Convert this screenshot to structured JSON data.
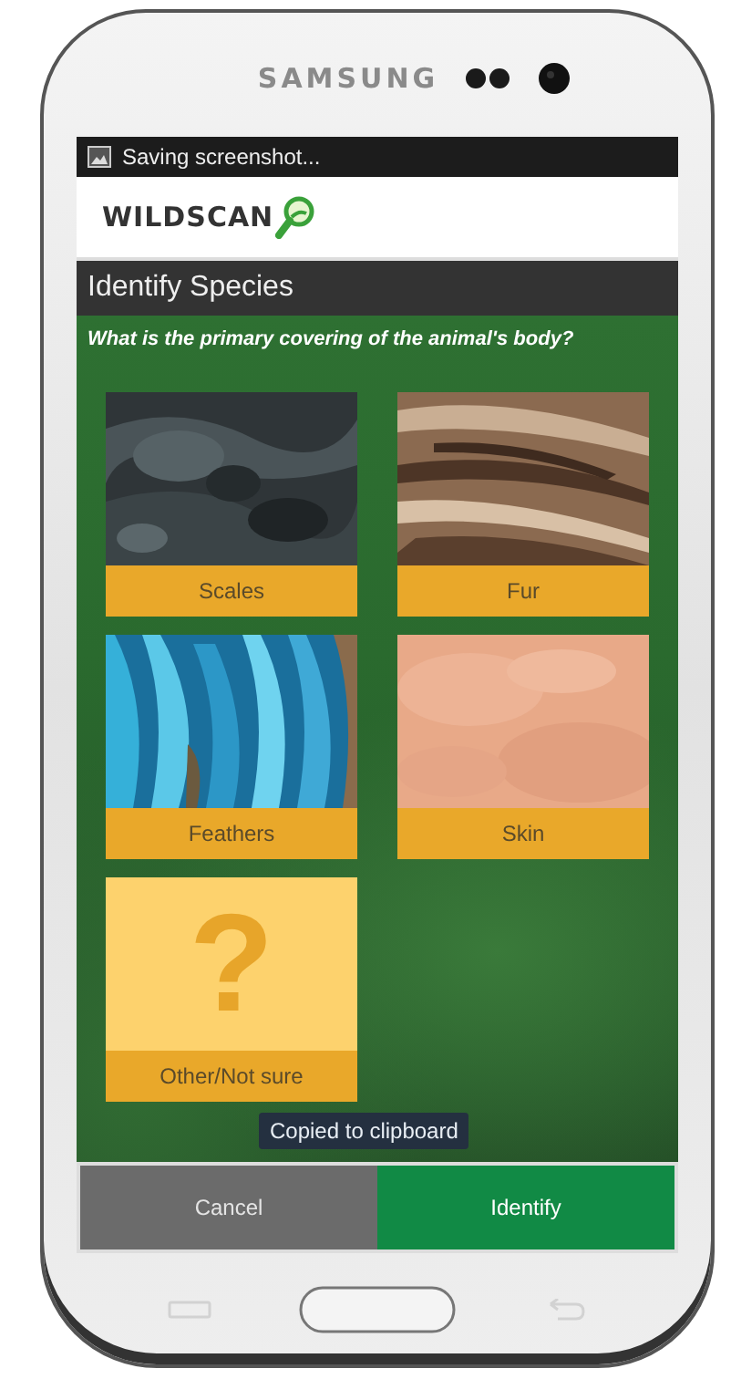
{
  "device": {
    "brand": "SAMSUNG"
  },
  "notification": {
    "text": "Saving screenshot..."
  },
  "app": {
    "logo": "WILDSCAN",
    "title": "Identify Species",
    "question": "What is the primary covering of the animal's body?"
  },
  "options": [
    {
      "label": "Scales",
      "kind": "scales"
    },
    {
      "label": "Fur",
      "kind": "fur"
    },
    {
      "label": "Feathers",
      "kind": "feathers"
    },
    {
      "label": "Skin",
      "kind": "skin"
    },
    {
      "label": "Other/Not sure",
      "kind": "unknown",
      "symbol": "?"
    }
  ],
  "toast": "Copied to clipboard",
  "buttons": [
    {
      "label": "Cancel",
      "kind": "secondary"
    },
    {
      "label": "Identify",
      "kind": "primary"
    }
  ]
}
